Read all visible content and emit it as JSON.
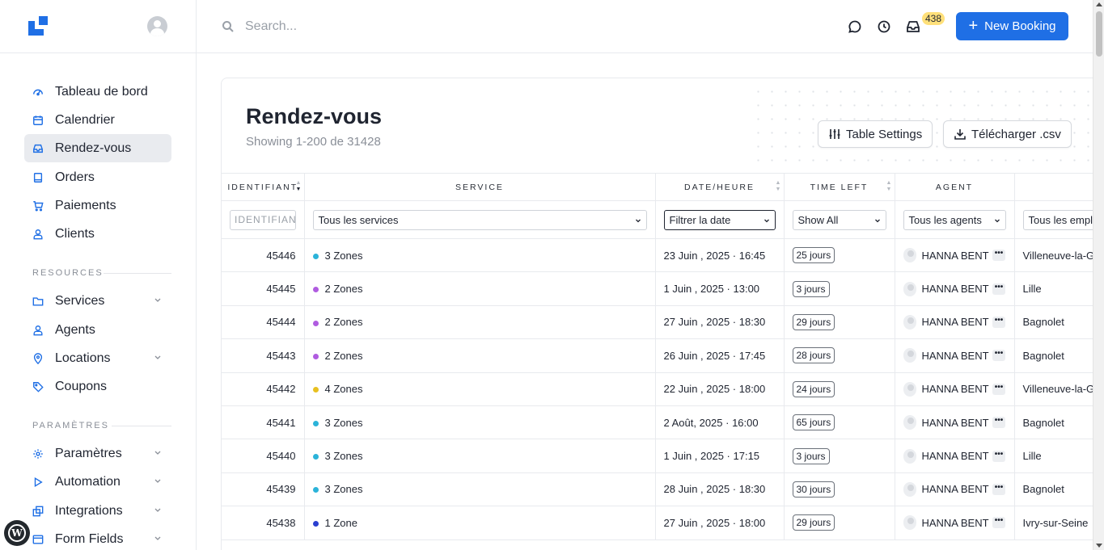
{
  "sidebar": {
    "nav": [
      {
        "label": "Tableau de bord"
      },
      {
        "label": "Calendrier"
      },
      {
        "label": "Rendez-vous"
      },
      {
        "label": "Orders"
      },
      {
        "label": "Paiements"
      },
      {
        "label": "Clients"
      }
    ],
    "resources_title": "RESOURCES",
    "resources": [
      {
        "label": "Services"
      },
      {
        "label": "Agents"
      },
      {
        "label": "Locations"
      },
      {
        "label": "Coupons"
      }
    ],
    "settings_title": "PARAMÈTRES",
    "settings": [
      {
        "label": "Paramètres"
      },
      {
        "label": "Automation"
      },
      {
        "label": "Integrations"
      },
      {
        "label": "Form Fields"
      }
    ]
  },
  "topbar": {
    "search_placeholder": "Search...",
    "notification_count": "438",
    "new_booking_label": "New Booking"
  },
  "page": {
    "title": "Rendez-vous",
    "subtitle": "Showing 1-200 de 31428",
    "table_settings_label": "Table Settings",
    "download_label": "Télécharger .csv"
  },
  "table": {
    "headers": [
      "IDENTIFIANT",
      "SERVICE",
      "DATE/HEURE",
      "TIME LEFT",
      "AGENT",
      ""
    ],
    "filters": {
      "id_placeholder": "IDENTIFIAN",
      "service": "Tous les services",
      "date": "Filtrer la date",
      "time_left": "Show All",
      "agent": "Tous les agents",
      "location": "Tous les empla"
    },
    "rows": [
      {
        "id": "45446",
        "service": "3 Zones",
        "color": "#2bb3d9",
        "date": "23 Juin , 2025 · 16:45",
        "left": "25 jours",
        "agent": "HANNA BENT",
        "location": "Villeneuve-la-G"
      },
      {
        "id": "45445",
        "service": "2 Zones",
        "color": "#b05ce0",
        "date": "1 Juin , 2025 · 13:00",
        "left": "3 jours",
        "agent": "HANNA BENT",
        "location": "Lille"
      },
      {
        "id": "45444",
        "service": "2 Zones",
        "color": "#b05ce0",
        "date": "27 Juin , 2025 · 18:30",
        "left": "29 jours",
        "agent": "HANNA BENT",
        "location": "Bagnolet"
      },
      {
        "id": "45443",
        "service": "2 Zones",
        "color": "#b05ce0",
        "date": "26 Juin , 2025 · 17:45",
        "left": "28 jours",
        "agent": "HANNA BENT",
        "location": "Bagnolet"
      },
      {
        "id": "45442",
        "service": "4 Zones",
        "color": "#e8c020",
        "date": "22 Juin , 2025 · 18:00",
        "left": "24 jours",
        "agent": "HANNA BENT",
        "location": "Villeneuve-la-G"
      },
      {
        "id": "45441",
        "service": "3 Zones",
        "color": "#2bb3d9",
        "date": "2 Août, 2025 · 16:00",
        "left": "65 jours",
        "agent": "HANNA BENT",
        "location": "Bagnolet"
      },
      {
        "id": "45440",
        "service": "3 Zones",
        "color": "#2bb3d9",
        "date": "1 Juin , 2025 · 17:15",
        "left": "3 jours",
        "agent": "HANNA BENT",
        "location": "Lille"
      },
      {
        "id": "45439",
        "service": "3 Zones",
        "color": "#2bb3d9",
        "date": "28 Juin , 2025 · 18:30",
        "left": "30 jours",
        "agent": "HANNA BENT",
        "location": "Bagnolet"
      },
      {
        "id": "45438",
        "service": "1 Zone",
        "color": "#2a3fd0",
        "date": "27 Juin , 2025 · 18:00",
        "left": "29 jours",
        "agent": "HANNA BENT",
        "location": "Ivry-sur-Seine"
      }
    ]
  },
  "colors": {
    "accent": "#1f6fe5",
    "badge": "#ffe07a"
  }
}
